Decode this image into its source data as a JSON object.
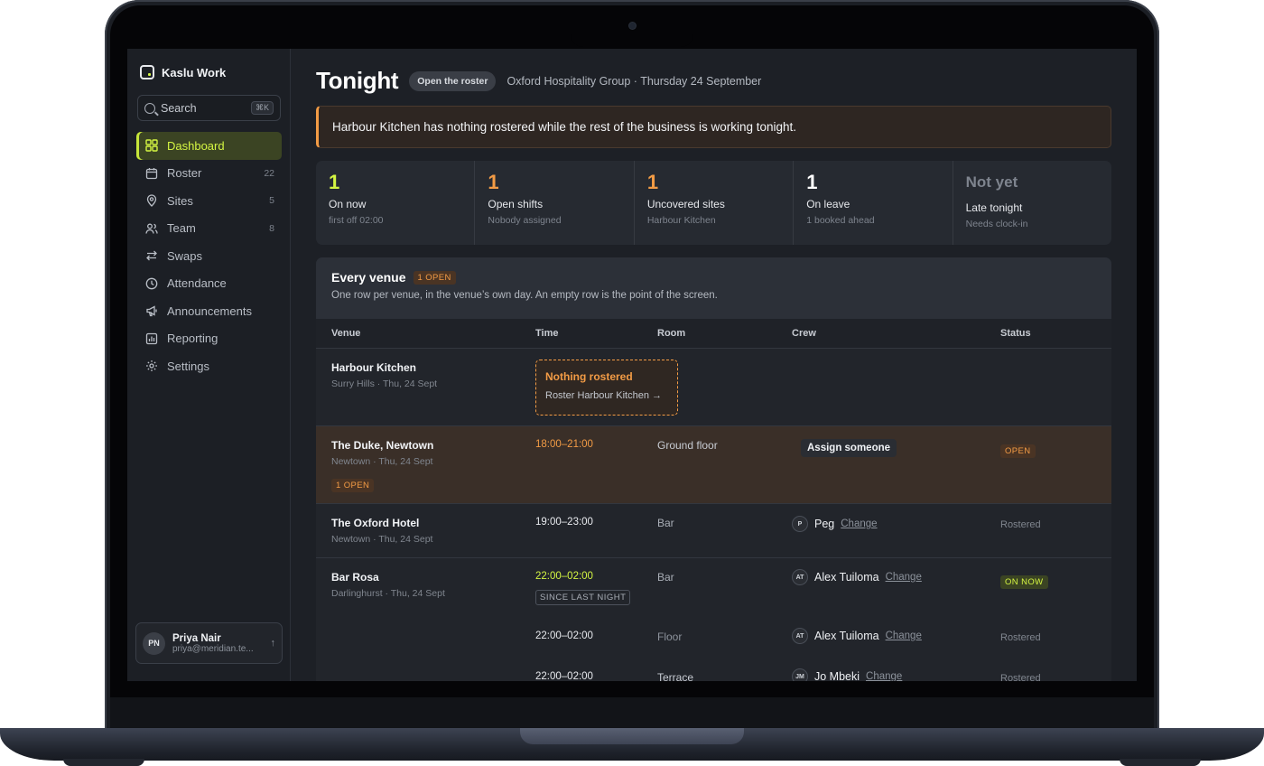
{
  "app": {
    "name": "Kaslu Work"
  },
  "search": {
    "label": "Search",
    "shortcut": "⌘K"
  },
  "sidebar": {
    "items": [
      {
        "label": "Dashboard",
        "icon": "grid-icon",
        "count": ""
      },
      {
        "label": "Roster",
        "icon": "calendar-icon",
        "count": "22"
      },
      {
        "label": "Sites",
        "icon": "map-pin-icon",
        "count": "5"
      },
      {
        "label": "Team",
        "icon": "users-icon",
        "count": "8"
      },
      {
        "label": "Swaps",
        "icon": "swap-icon",
        "count": ""
      },
      {
        "label": "Attendance",
        "icon": "clock-icon",
        "count": ""
      },
      {
        "label": "Announcements",
        "icon": "megaphone-icon",
        "count": ""
      },
      {
        "label": "Reporting",
        "icon": "chart-icon",
        "count": ""
      },
      {
        "label": "Settings",
        "icon": "gear-icon",
        "count": ""
      }
    ]
  },
  "profile": {
    "initials": "PN",
    "name": "Priya Nair",
    "email": "priya@meridian.te..."
  },
  "header": {
    "title": "Tonight",
    "button": "Open the roster",
    "subtitle": "Oxford Hospitality Group · Thursday 24 September"
  },
  "alert": {
    "text": "Harbour Kitchen has nothing rostered while the rest of the business is working tonight."
  },
  "stats": [
    {
      "value": "1",
      "label": "On now",
      "sub": "first off 02:00",
      "color": "#d4f542"
    },
    {
      "value": "1",
      "label": "Open shifts",
      "sub": "Nobody assigned",
      "color": "#f29b45"
    },
    {
      "value": "1",
      "label": "Uncovered sites",
      "sub": "Harbour Kitchen",
      "color": "#f29b45"
    },
    {
      "value": "1",
      "label": "On leave",
      "sub": "1 booked ahead",
      "color": "#ffffff"
    },
    {
      "value": "Not yet",
      "label": "Late tonight",
      "sub": "Needs clock-in",
      "color": "#7e848e"
    }
  ],
  "table": {
    "title": "Every venue",
    "badge": "1 OPEN",
    "description": "One row per venue, in the venue’s own day. An empty row is the point of the screen.",
    "columns": [
      "Venue",
      "Time",
      "Room",
      "Crew",
      "Status"
    ],
    "rows": [
      {
        "venue": "Harbour Kitchen",
        "sub": "Surry Hills · Thu, 24 Sept",
        "empty_title": "Nothing rostered",
        "empty_link": "Roster Harbour Kitchen →"
      },
      {
        "venue": "The Duke, Newtown",
        "sub": "Newtown · Thu, 24 Sept",
        "badge": "1 OPEN",
        "time": "18:00–21:00",
        "room": "Ground floor",
        "assign": "Assign someone",
        "status": "OPEN"
      },
      {
        "venue": "The Oxford Hotel",
        "sub": "Newtown · Thu, 24 Sept",
        "time": "19:00–23:00",
        "room": "Bar",
        "initials": "P",
        "crew": "Peg",
        "change": "Change",
        "status": "Rostered"
      },
      {
        "venue": "Bar Rosa",
        "sub": "Darlinghurst · Thu, 24 Sept",
        "shifts": [
          {
            "time": "22:00–02:00",
            "tag": "SINCE LAST NIGHT",
            "room": "Bar",
            "initials": "AT",
            "crew": "Alex Tuiloma",
            "change": "Change",
            "status": "ON NOW"
          },
          {
            "time": "22:00–02:00",
            "room": "Floor",
            "initials": "AT",
            "crew": "Alex Tuiloma",
            "change": "Change",
            "status": "Rostered"
          },
          {
            "time": "22:00–02:00",
            "room": "Terrace",
            "initials": "JM",
            "crew": "Jo Mbeki",
            "change": "Change",
            "status": "Rostered"
          }
        ]
      }
    ]
  }
}
